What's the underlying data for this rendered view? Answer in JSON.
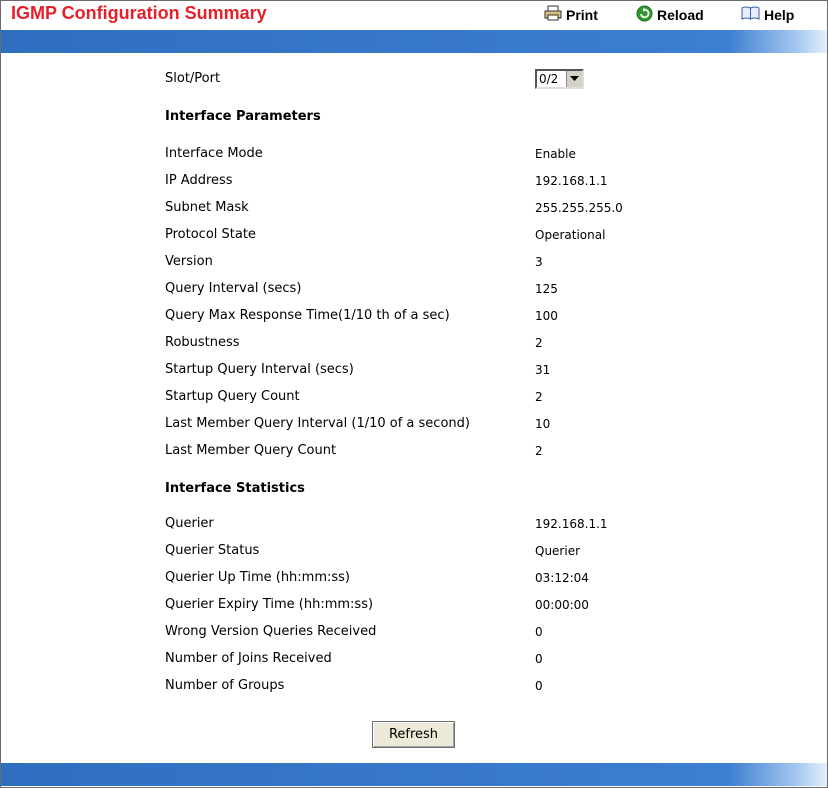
{
  "header": {
    "title": "IGMP Configuration Summary",
    "print_label": "Print",
    "reload_label": "Reload",
    "help_label": "Help"
  },
  "slot_port": {
    "label": "Slot/Port",
    "value": "0/2"
  },
  "interface_parameters": {
    "heading": "Interface Parameters",
    "rows": [
      {
        "label": "Interface Mode",
        "value": "Enable"
      },
      {
        "label": "IP Address",
        "value": "192.168.1.1"
      },
      {
        "label": "Subnet Mask",
        "value": "255.255.255.0"
      },
      {
        "label": "Protocol State",
        "value": "Operational"
      },
      {
        "label": "Version",
        "value": "3"
      },
      {
        "label": "Query Interval (secs)",
        "value": "125"
      },
      {
        "label": "Query Max Response Time(1/10 th of a sec)",
        "value": "100"
      },
      {
        "label": "Robustness",
        "value": "2"
      },
      {
        "label": "Startup Query Interval (secs)",
        "value": "31"
      },
      {
        "label": "Startup Query Count",
        "value": "2"
      },
      {
        "label": "Last Member Query Interval (1/10 of a second)",
        "value": "10"
      },
      {
        "label": "Last Member Query Count",
        "value": "2"
      }
    ]
  },
  "interface_statistics": {
    "heading": "Interface Statistics",
    "rows": [
      {
        "label": "Querier",
        "value": "192.168.1.1"
      },
      {
        "label": "Querier Status",
        "value": "Querier"
      },
      {
        "label": "Querier Up Time (hh:mm:ss)",
        "value": "03:12:04"
      },
      {
        "label": "Querier Expiry Time (hh:mm:ss)",
        "value": "00:00:00"
      },
      {
        "label": "Wrong Version Queries Received",
        "value": "0"
      },
      {
        "label": "Number of Joins Received",
        "value": "0"
      },
      {
        "label": "Number of Groups",
        "value": "0"
      }
    ]
  },
  "actions": {
    "refresh_label": "Refresh"
  },
  "colors": {
    "title": "#e4202a",
    "bar": "#3c7ed0",
    "reload_icon": "#2e9a2e"
  }
}
